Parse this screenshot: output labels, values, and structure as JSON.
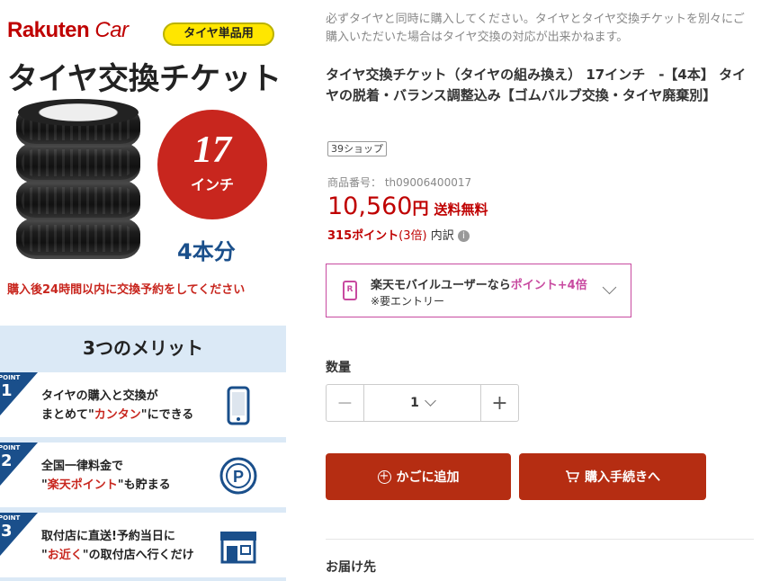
{
  "promo": {
    "brand_main": "Rakuten",
    "brand_sub": "Car",
    "tag": "タイヤ単品用",
    "title": "タイヤ交換チケット",
    "size_number": "17",
    "size_unit": "インチ",
    "quantity_label": "4本分",
    "notice": "購入後24時間以内に交換予約をしてください",
    "merits_title": "3つのメリット",
    "point_label": "POINT",
    "merits": [
      {
        "no": "1",
        "line1": "タイヤの購入と交換が",
        "line2_pre": "まとめて\"",
        "line2_hl": "カンタン",
        "line2_post": "\"にできる",
        "icon": "smartphone-icon"
      },
      {
        "no": "2",
        "line1": "全国一律料金で",
        "line2_pre": "\"",
        "line2_hl": "楽天ポイント",
        "line2_post": "\"も貯まる",
        "icon": "point-coin-icon"
      },
      {
        "no": "3",
        "line1": "取付店に直送!予約当日に",
        "line2_pre": "\"",
        "line2_hl": "お近く",
        "line2_post": "\"の取付店へ行くだけ",
        "icon": "shop-icon"
      }
    ]
  },
  "product": {
    "note": "必ずタイヤと同時に購入してください。タイヤとタイヤ交換チケットを別々にご購入いただいた場合はタイヤ交換の対応が出来かねます。",
    "title": "タイヤ交換チケット（タイヤの組み換え） 17インチ　-【4本】 タイヤの脱着・バランス調整込み【ゴムバルブ交換・タイヤ廃棄別】",
    "shop_badge": "39ショップ",
    "item_number": "商品番号： th09006400017",
    "price": "10,560",
    "currency": "円",
    "shipping": "送料無料",
    "points": "315ポイント",
    "points_multiplier": "(3倍)",
    "points_breakdown": "内訳",
    "mobile_promo": {
      "prefix": "楽天モバイルユーザーなら",
      "accent": "ポイント+4倍",
      "entry_note": "※要エントリー"
    },
    "quantity_title": "数量",
    "quantity_value": "1",
    "cart_button": "かごに追加",
    "buy_button": "購入手続きへ",
    "delivery_title": "お届け先"
  },
  "colors": {
    "rakuten_red": "#bf0000",
    "button_red": "#b52d12",
    "mobile_pink": "#c84aa0",
    "merit_blue": "#1a4f8b"
  }
}
